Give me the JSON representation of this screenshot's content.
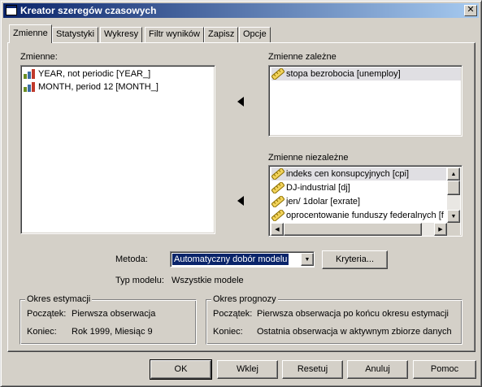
{
  "window": {
    "title": "Kreator szeregów czasowych",
    "close_glyph": "✕"
  },
  "tabs": [
    {
      "label": "Zmienne",
      "active": true
    },
    {
      "label": "Statystyki"
    },
    {
      "label": "Wykresy"
    },
    {
      "label": "Filtr wyników"
    },
    {
      "label": "Zapisz"
    },
    {
      "label": "Opcje"
    }
  ],
  "variables": {
    "label": "Zmienne:",
    "items": [
      {
        "text": "YEAR, not periodic [YEAR_]",
        "icon": "nominal-icon"
      },
      {
        "text": "MONTH, period 12 [MONTH_]",
        "icon": "nominal-icon"
      }
    ]
  },
  "dependent": {
    "label": "Zmienne zależne",
    "items": [
      {
        "text": "stopa bezrobocia [unemploy]",
        "icon": "scale-ruler-icon"
      }
    ]
  },
  "independent": {
    "label": "Zmienne niezależne",
    "items": [
      {
        "text": "indeks cen konsupcyjnych [cpi]",
        "icon": "scale-ruler-icon"
      },
      {
        "text": "DJ-industrial [dj]",
        "icon": "scale-ruler-icon"
      },
      {
        "text": "jen/ 1dolar [exrate]",
        "icon": "scale-ruler-icon"
      },
      {
        "text": "oprocentowanie funduszy federalnych [f",
        "icon": "scale-ruler-icon"
      }
    ]
  },
  "method": {
    "label": "Metoda:",
    "value": "Automatyczny dobór modelu",
    "criteria_button": "Kryteria..."
  },
  "model_type": {
    "label": "Typ modelu:",
    "value": "Wszystkie modele"
  },
  "estimation": {
    "legend": "Okres estymacji",
    "start_label": "Początek:",
    "start_value": "Pierwsza obserwacja",
    "end_label": "Koniec:",
    "end_value": "Rok 1999, Miesiąc 9"
  },
  "forecast": {
    "legend": "Okres prognozy",
    "start_label": "Początek:",
    "start_value": "Pierwsza obserwacja po końcu okresu estymacji",
    "end_label": "Koniec:",
    "end_value": "Ostatnia obserwacja w aktywnym zbiorze danych"
  },
  "buttons": {
    "ok": "OK",
    "paste": "Wklej",
    "reset": "Resetuj",
    "cancel": "Anuluj",
    "help": "Pomoc"
  },
  "colors": {
    "titlebar_start": "#0a246a",
    "titlebar_end": "#a6caf0",
    "selection": "#0a246a",
    "face": "#d4d0c8"
  }
}
